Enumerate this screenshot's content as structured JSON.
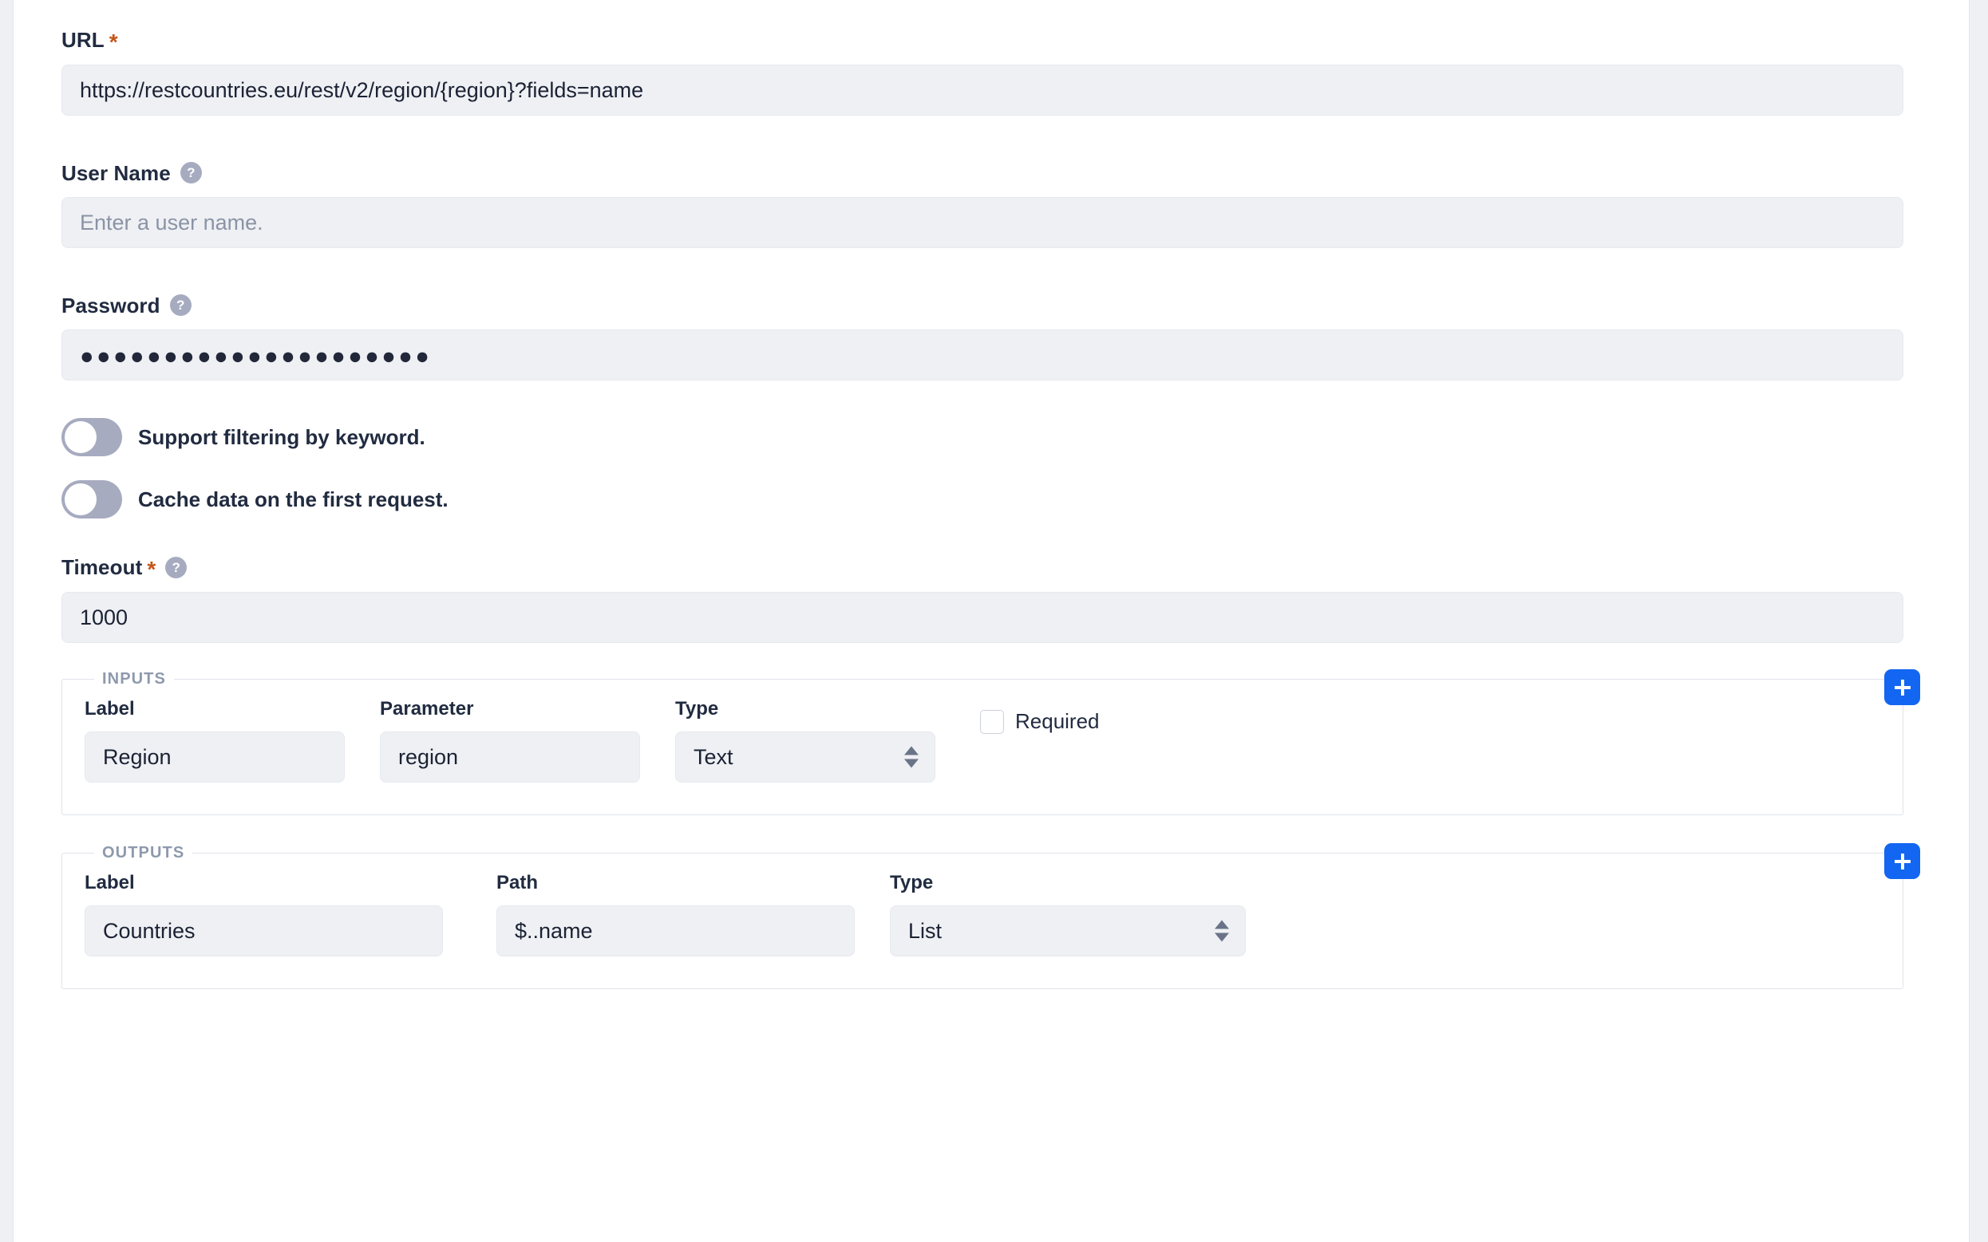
{
  "form": {
    "url": {
      "label": "URL",
      "required_mark": "*",
      "value": "https://restcountries.eu/rest/v2/region/{region}?fields=name"
    },
    "user_name": {
      "label": "User Name",
      "help": "?",
      "value": "",
      "placeholder": "Enter a user name."
    },
    "password": {
      "label": "Password",
      "help": "?",
      "value": "●●●●●●●●●●●●●●●●●●●●●"
    },
    "toggles": [
      {
        "label": "Support filtering by keyword.",
        "state": "off"
      },
      {
        "label": "Cache data on the first request.",
        "state": "off"
      }
    ],
    "timeout": {
      "label": "Timeout",
      "required_mark": "*",
      "help": "?",
      "value": "1000"
    }
  },
  "inputs_section": {
    "legend": "INPUTS",
    "add_button": "+",
    "columns": {
      "label": "Label",
      "parameter": "Parameter",
      "type": "Type",
      "required": "Required"
    },
    "rows": [
      {
        "label_value": "Region",
        "parameter_value": "region",
        "type_value": "Text",
        "required_checked": false
      }
    ]
  },
  "outputs_section": {
    "legend": "OUTPUTS",
    "add_button": "+",
    "columns": {
      "label": "Label",
      "path": "Path",
      "type": "Type"
    },
    "rows": [
      {
        "label_value": "Countries",
        "path_value": "$..name",
        "type_value": "List"
      }
    ]
  },
  "colors": {
    "accent_blue": "#1266f1",
    "required_star": "#c35617",
    "input_bg": "#eef0f4",
    "label_text": "#212b40",
    "legend_text": "#8e99ad",
    "toggle_track": "#a7abc0",
    "help_icon_bg": "#a7abc0"
  }
}
